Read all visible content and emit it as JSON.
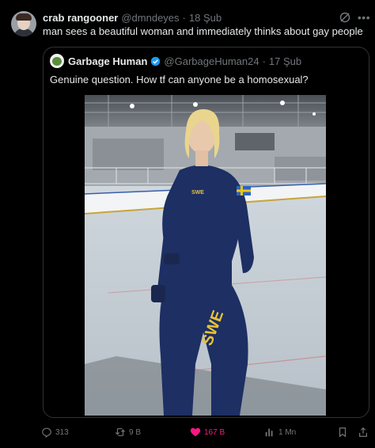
{
  "tweet": {
    "display_name": "crab rangooner",
    "handle": "@dmndeyes",
    "separator": "·",
    "time": "18 Şub",
    "text": "man sees a beautiful woman and immediately thinks about gay people"
  },
  "quote": {
    "display_name": "Garbage Human",
    "handle": "@GarbageHuman24",
    "separator": "·",
    "time": "17 Şub",
    "text": "Genuine question. How tf can anyone be a homosexual?",
    "media": {
      "jersey_text": "SWE",
      "chest_text": "SWE"
    }
  },
  "actions": {
    "replies": "313",
    "reposts": "9 B",
    "likes": "167 B",
    "views": "1 Mn"
  },
  "colors": {
    "background": "#000000",
    "text_primary": "#e7e9ea",
    "text_secondary": "#71767b",
    "border": "#2f3336",
    "like_active": "#f91880",
    "verified": "#1d9bf0"
  },
  "icons": [
    "grok-icon",
    "more-icon",
    "verified-icon",
    "reply-icon",
    "repost-icon",
    "like-icon",
    "views-icon",
    "bookmark-icon",
    "share-icon"
  ]
}
